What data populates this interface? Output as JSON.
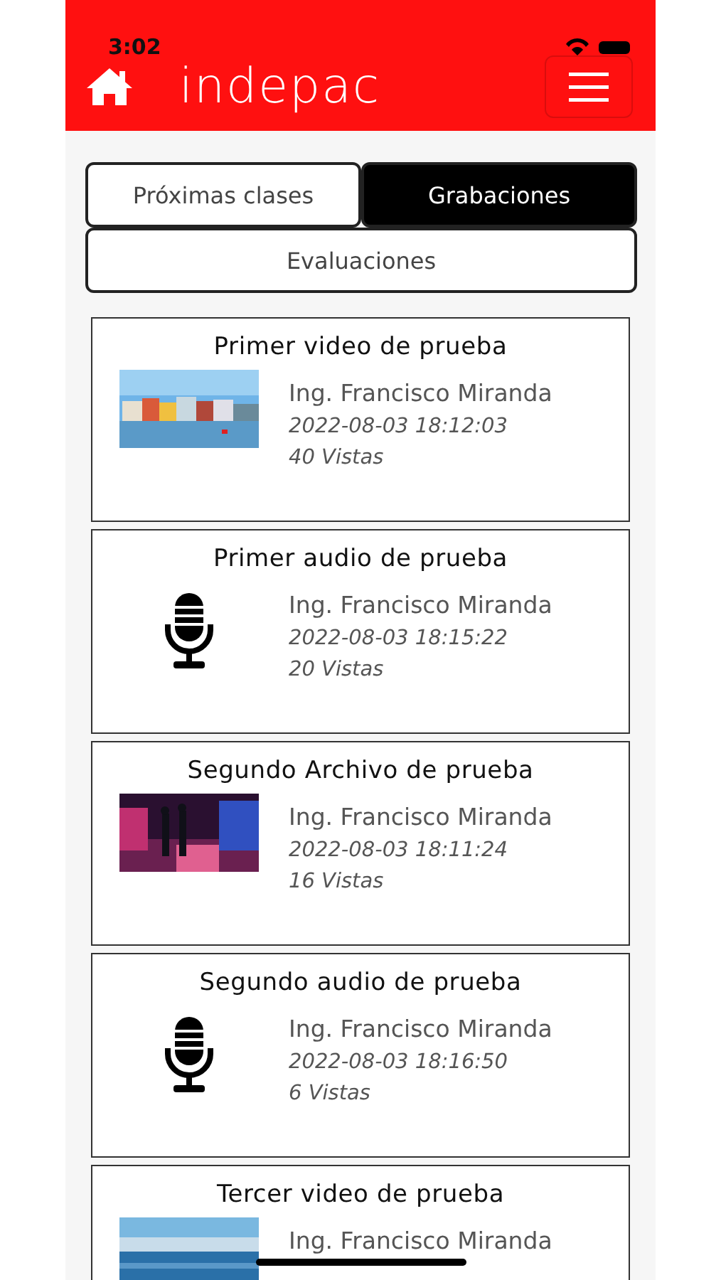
{
  "status_bar": {
    "time": "3:02"
  },
  "header": {
    "logo": "indepac"
  },
  "tabs": [
    {
      "label": "Próximas clases",
      "selected": false
    },
    {
      "label": "Grabaciones",
      "selected": true
    },
    {
      "label": "Evaluaciones",
      "selected": false
    }
  ],
  "recordings": [
    {
      "title": "Primer video de prueba",
      "kind": "video",
      "author": "Ing. Francisco Miranda",
      "date": "2022-08-03 18:12:03",
      "views": "40 Vistas"
    },
    {
      "title": "Primer audio de prueba",
      "kind": "audio",
      "author": "Ing. Francisco Miranda",
      "date": "2022-08-03 18:15:22",
      "views": "20 Vistas"
    },
    {
      "title": "Segundo Archivo de prueba",
      "kind": "video",
      "author": "Ing. Francisco Miranda",
      "date": "2022-08-03 18:11:24",
      "views": "16 Vistas"
    },
    {
      "title": "Segundo audio de prueba",
      "kind": "audio",
      "author": "Ing. Francisco Miranda",
      "date": "2022-08-03 18:16:50",
      "views": "6 Vistas"
    },
    {
      "title": "Tercer video de prueba",
      "kind": "video",
      "author": "Ing. Francisco Miranda"
    }
  ]
}
